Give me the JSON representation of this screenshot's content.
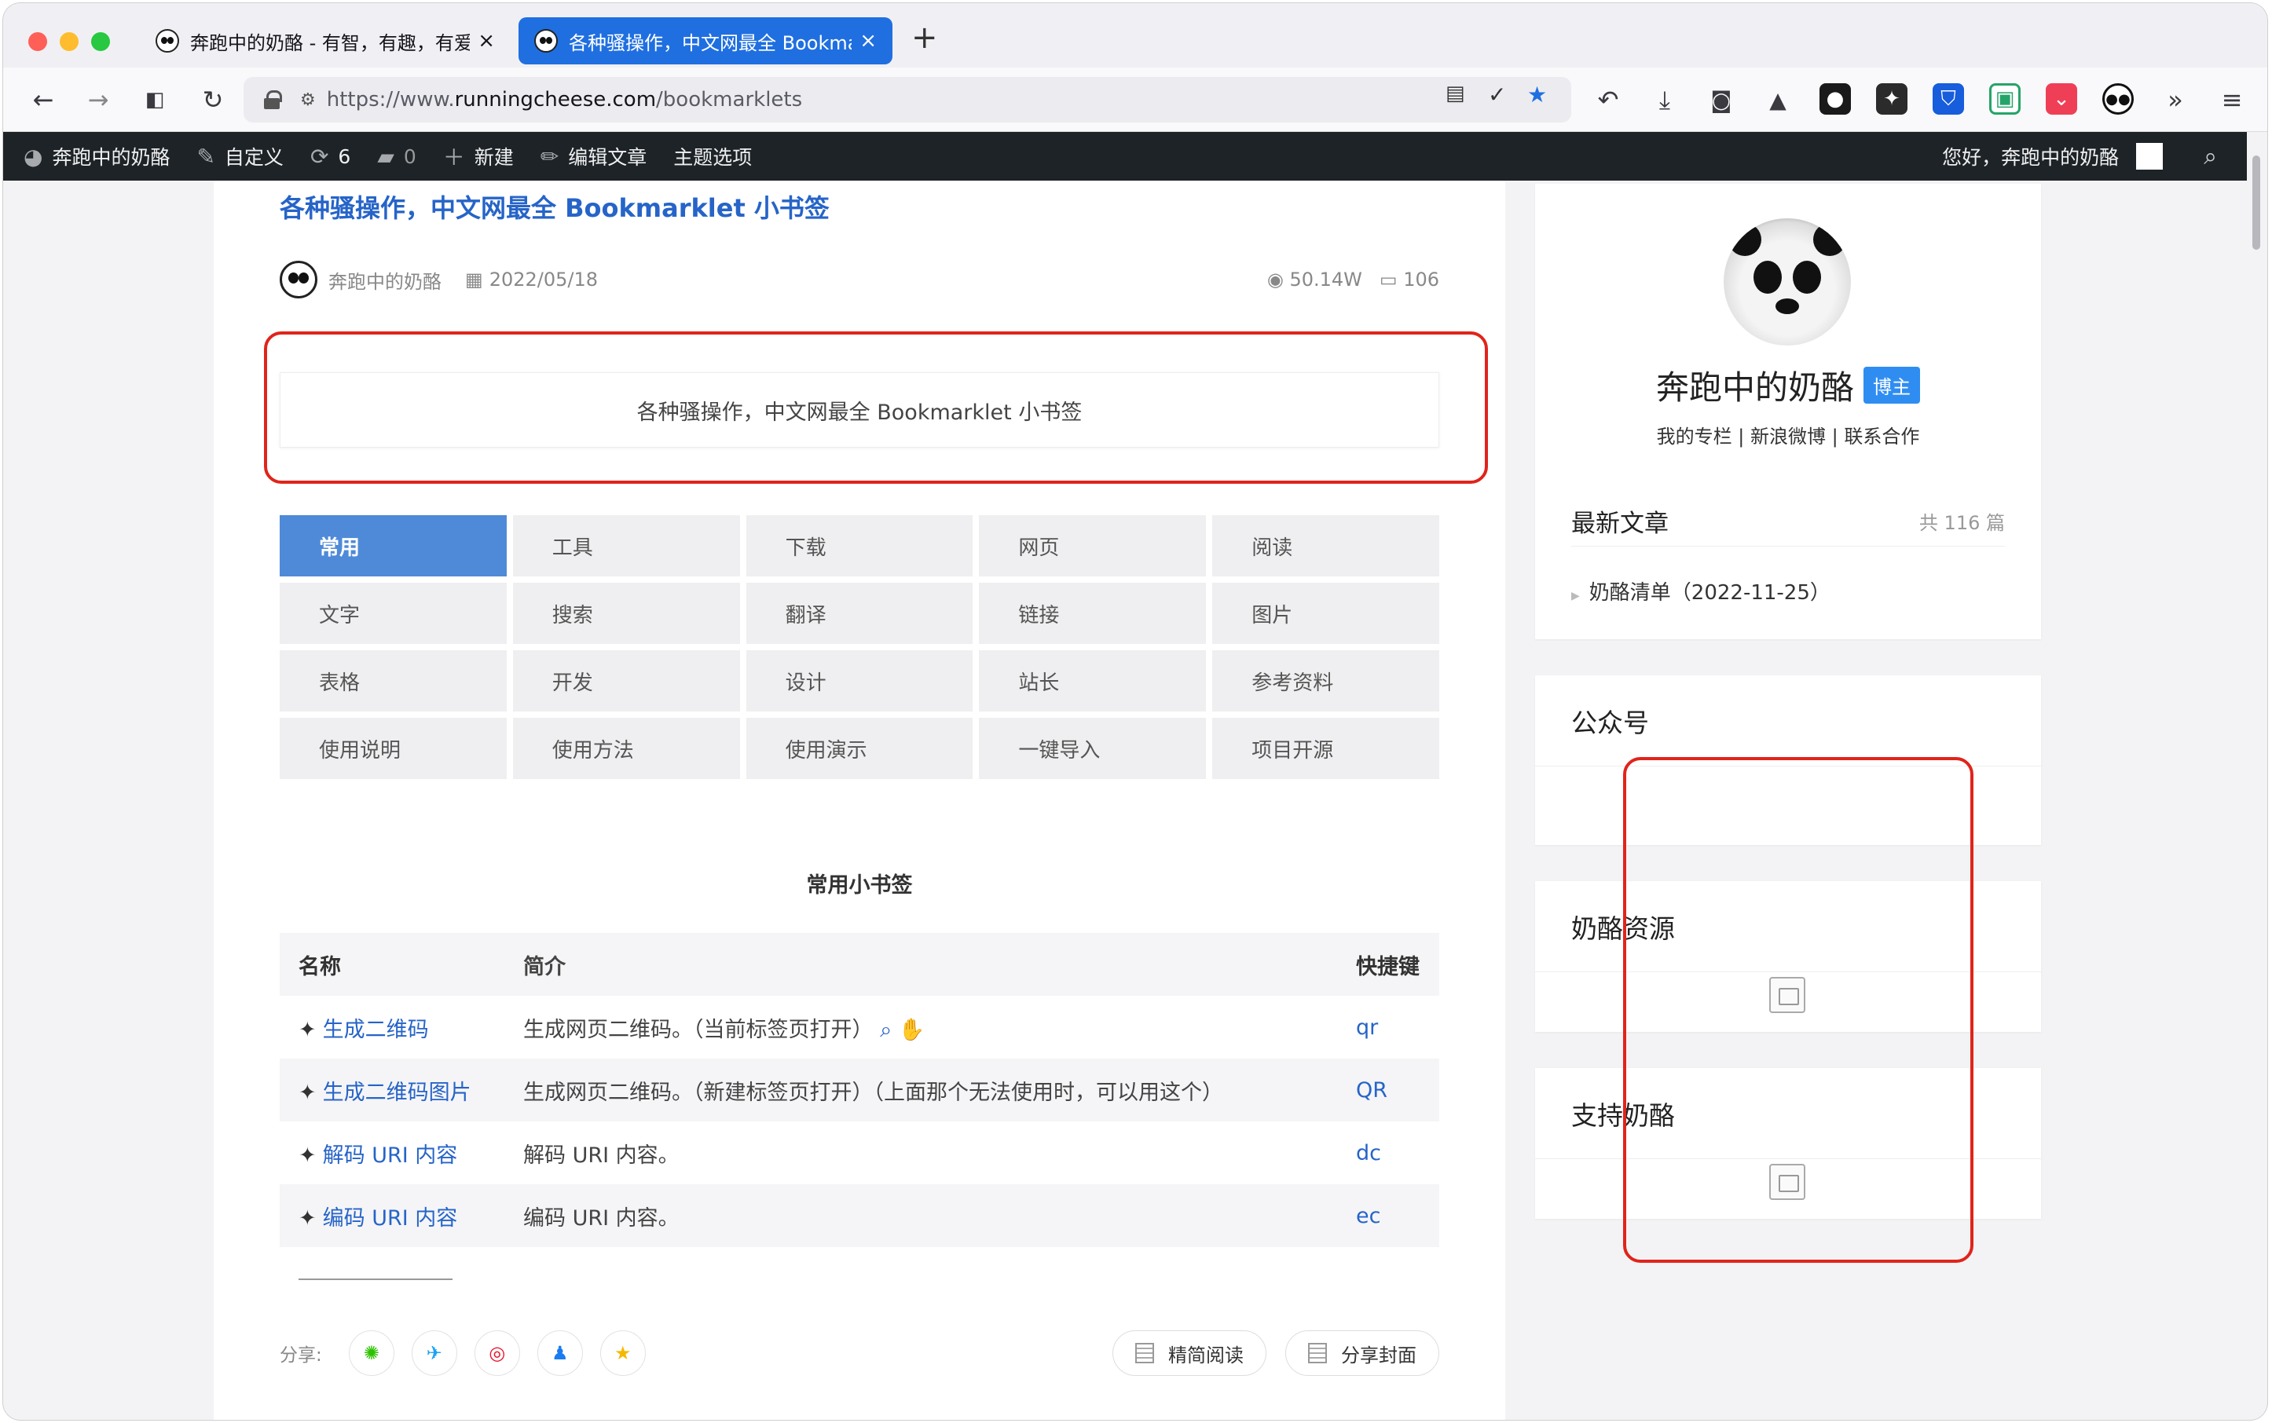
{
  "browser": {
    "tabs": [
      {
        "title": "奔跑中的奶酪 - 有智，有趣，有爱",
        "active": false
      },
      {
        "title": "各种骚操作，中文网最全 Bookmarklet",
        "active": true
      }
    ],
    "new_tab": "+",
    "url_prefix": "https://www.",
    "url_host": "runningcheese.com",
    "url_path": "/bookmarklets",
    "icons": [
      "back-icon",
      "forward-icon",
      "sidebar-icon",
      "reload-icon",
      "lock-icon",
      "permissions-icon",
      "reader-view-icon",
      "check-icon",
      "bookmark-star-icon",
      "undo-icon",
      "download-icon",
      "camera-icon",
      "rocket-icon",
      "extension-icon",
      "extension-icon",
      "bitwarden-icon",
      "save-icon",
      "pocket-icon",
      "panda-icon",
      "overflow-icon",
      "menu-icon"
    ],
    "colors": {
      "accent": "#1f6fe0",
      "traffic": [
        "#fe5f57",
        "#febc2e",
        "#28c840"
      ]
    }
  },
  "adminbar": {
    "site": "奔跑中的奶酪",
    "customize": "自定义",
    "updates": "6",
    "comments": "0",
    "new": "新建",
    "edit": "编辑文章",
    "theme": "主题选项",
    "greeting": "您好，奔跑中的奶酪"
  },
  "post": {
    "title": "各种骚操作，中文网最全 Bookmarklet 小书签",
    "author": "奔跑中的奶酪",
    "date": "2022/05/18",
    "views": "50.14W",
    "comments": "106",
    "summary": "各种骚操作，中文网最全 Bookmarklet 小书签"
  },
  "categories": [
    "常用",
    "工具",
    "下载",
    "网页",
    "阅读",
    "文字",
    "搜索",
    "翻译",
    "链接",
    "图片",
    "表格",
    "开发",
    "设计",
    "站长",
    "参考资料",
    "使用说明",
    "使用方法",
    "使用演示",
    "一键导入",
    "项目开源"
  ],
  "table": {
    "caption": "常用小书签",
    "headers": [
      "名称",
      "简介",
      "快捷键"
    ],
    "rows": [
      {
        "name": "生成二维码",
        "desc": "生成网页二维码。（当前标签页打开）",
        "key": "qr"
      },
      {
        "name": "生成二维码图片",
        "desc": "生成网页二维码。（新建标签页打开）（上面那个无法使用时，可以用这个）",
        "key": "QR"
      },
      {
        "name": "解码 URI 内容",
        "desc": "解码 URI 内容。",
        "key": "dc"
      },
      {
        "name": "编码 URI 内容",
        "desc": "编码 URI 内容。",
        "key": "ec"
      }
    ]
  },
  "share": {
    "label": "分享:",
    "reader": "精简阅读",
    "cover": "分享封面"
  },
  "sidebar": {
    "name": "奔跑中的奶酪",
    "badge": "博主",
    "links": "我的专栏 | 新浪微博 | 联系合作",
    "recent_title": "最新文章",
    "recent_count": "共 116 篇",
    "recent_item": "奶酪清单（2022-11-25）",
    "w1": "公众号",
    "w2": "奶酪资源",
    "w3": "支持奶酪"
  }
}
